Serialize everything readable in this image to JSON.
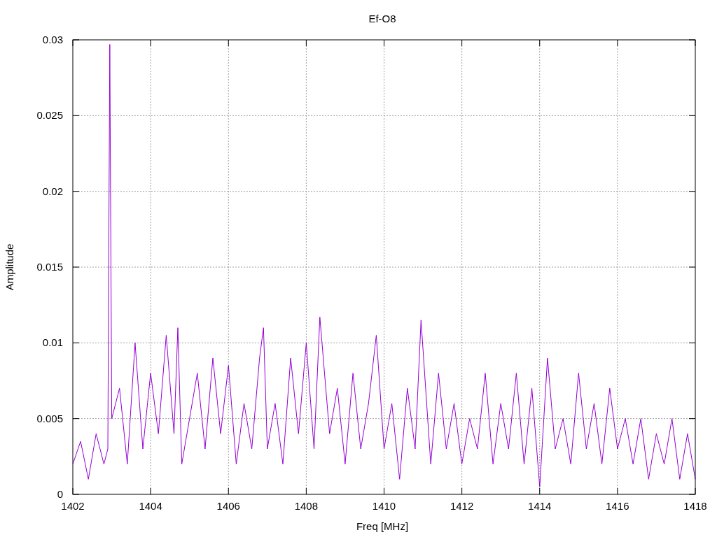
{
  "chart_data": {
    "type": "line",
    "grid": true,
    "title": "Ef-O8",
    "xlabel": "Freq [MHz]",
    "ylabel": "Amplitude",
    "xlim": [
      1402,
      1418
    ],
    "ylim": [
      0,
      0.03
    ],
    "xticks": [
      1402,
      1404,
      1406,
      1408,
      1410,
      1412,
      1414,
      1416,
      1418
    ],
    "yticks": [
      0,
      0.005,
      0.01,
      0.015,
      0.02,
      0.025,
      0.03
    ],
    "x": [
      1402.0,
      1402.2,
      1402.4,
      1402.6,
      1402.8,
      1402.9,
      1402.95,
      1403.0,
      1403.2,
      1403.4,
      1403.6,
      1403.8,
      1404.0,
      1404.2,
      1404.4,
      1404.6,
      1404.7,
      1404.8,
      1405.0,
      1405.2,
      1405.4,
      1405.6,
      1405.8,
      1406.0,
      1406.2,
      1406.4,
      1406.6,
      1406.8,
      1406.9,
      1407.0,
      1407.2,
      1407.4,
      1407.6,
      1407.8,
      1408.0,
      1408.2,
      1408.35,
      1408.6,
      1408.8,
      1409.0,
      1409.2,
      1409.4,
      1409.6,
      1409.8,
      1410.0,
      1410.2,
      1410.4,
      1410.6,
      1410.8,
      1410.95,
      1411.2,
      1411.4,
      1411.6,
      1411.8,
      1412.0,
      1412.2,
      1412.4,
      1412.6,
      1412.8,
      1413.0,
      1413.2,
      1413.4,
      1413.6,
      1413.8,
      1414.0,
      1414.2,
      1414.4,
      1414.6,
      1414.8,
      1415.0,
      1415.2,
      1415.4,
      1415.6,
      1415.8,
      1416.0,
      1416.2,
      1416.4,
      1416.6,
      1416.8,
      1417.0,
      1417.2,
      1417.4,
      1417.6,
      1417.8,
      1418.0
    ],
    "series": [
      {
        "color": "#9400d3",
        "values": [
          0.002,
          0.0035,
          0.001,
          0.004,
          0.002,
          0.003,
          0.0297,
          0.005,
          0.007,
          0.002,
          0.01,
          0.003,
          0.008,
          0.004,
          0.0105,
          0.004,
          0.011,
          0.002,
          0.005,
          0.008,
          0.003,
          0.009,
          0.004,
          0.0085,
          0.002,
          0.006,
          0.003,
          0.009,
          0.011,
          0.003,
          0.006,
          0.002,
          0.009,
          0.004,
          0.01,
          0.003,
          0.0117,
          0.004,
          0.007,
          0.002,
          0.008,
          0.003,
          0.006,
          0.0105,
          0.003,
          0.006,
          0.001,
          0.007,
          0.003,
          0.0115,
          0.002,
          0.008,
          0.003,
          0.006,
          0.002,
          0.005,
          0.003,
          0.008,
          0.002,
          0.006,
          0.003,
          0.008,
          0.002,
          0.007,
          0.0005,
          0.009,
          0.003,
          0.005,
          0.002,
          0.008,
          0.003,
          0.006,
          0.002,
          0.007,
          0.003,
          0.005,
          0.002,
          0.005,
          0.001,
          0.004,
          0.002,
          0.005,
          0.001,
          0.004,
          0.001
        ]
      }
    ]
  }
}
